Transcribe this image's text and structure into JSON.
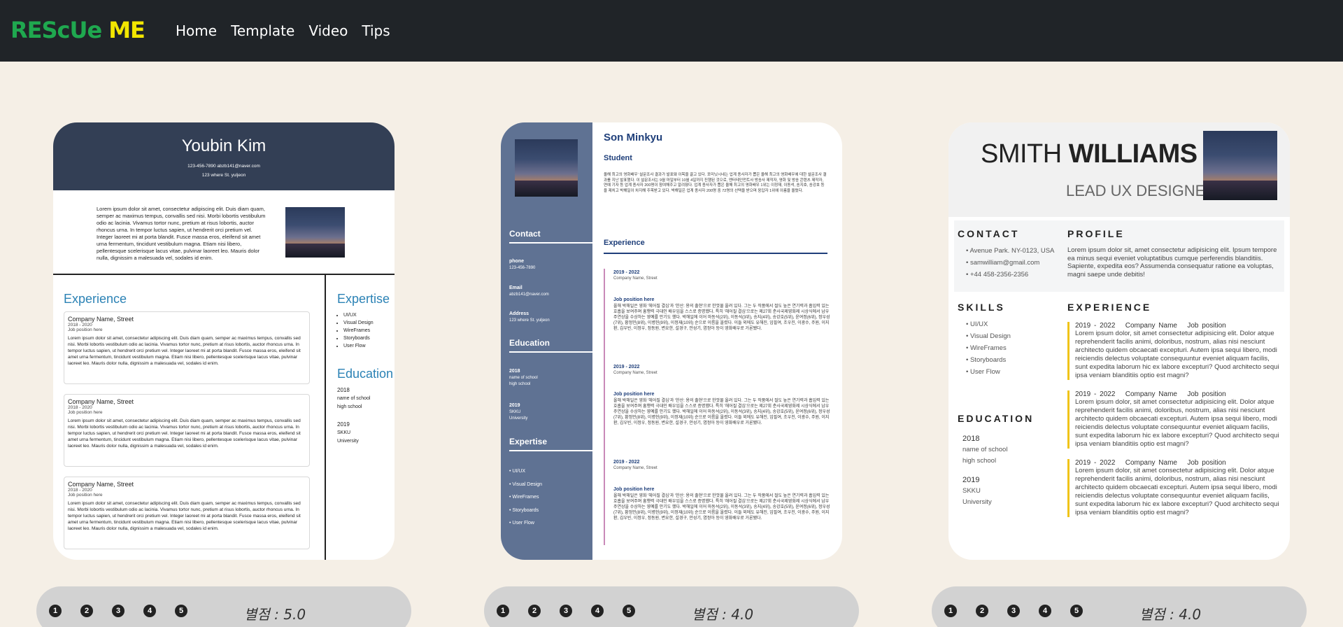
{
  "header": {
    "logo_part1": "REScUe",
    "logo_part2": "ME",
    "nav": [
      "Home",
      "Template",
      "Video",
      "Tips"
    ]
  },
  "card1": {
    "name": "Youbin Kim",
    "contact_line": "123-456-7890     abzb141@naver.com",
    "address": "123 where St. yuljeon",
    "intro": "Lorem ipsum dolor sit amet, consectetur adipiscing elit. Duis diam quam, semper ac maximus tempus, convallis sed nisi. Morbi lobortis vestibulum odio ac lacinia. Vivamus tortor nunc, pretium at risus lobortis, auctor rhoncus urna. In tempor luctus sapien, ut hendrerit orci pretium vel. Integer laoreet mi at porta blandit. Fusce massa eros, eleifend sit amet urna fermentum, tincidunt vestibulum magna. Etiam nisi libero, pellentesque scelerisque lacus vitae, pulvinar laoreet leo. Mauris dolor nulla, dignissim a malesuada vel, sodales id enim.",
    "experience_title": "Experience",
    "jobs": [
      {
        "company": "Company Name, Street",
        "dates": "2018 - 2020",
        "position": "Job position here",
        "body": "Lorem ipsum dolor sit amet, consectetur adipiscing elit. Duis diam quam, semper ac maximus tempus, convallis sed nisi. Morbi lobortis vestibulum odio ac lacinia. Vivamus tortor nunc, pretium at risus lobortis, auctor rhoncus urna. In tempor luctus sapien, ut hendrerit orci pretium vel. Integer laoreet mi at porta blandit. Fusce massa eros, eleifend sit amet urna fermentum, tincidunt vestibulum magna. Etiam nisi libero, pellentesque scelerisque lacus vitae, pulvinar laoreet leo. Mauris dolor nulla, dignissim a malesuada vel, sodales id enim."
      },
      {
        "company": "Company Name, Street",
        "dates": "2018 - 2020",
        "position": "Job position here",
        "body": "Lorem ipsum dolor sit amet, consectetur adipiscing elit. Duis diam quam, semper ac maximus tempus, convallis sed nisi. Morbi lobortis vestibulum odio ac lacinia. Vivamus tortor nunc, pretium at risus lobortis, auctor rhoncus urna. In tempor luctus sapien, ut hendrerit orci pretium vel. Integer laoreet mi at porta blandit. Fusce massa eros, eleifend sit amet urna fermentum, tincidunt vestibulum magna. Etiam nisi libero, pellentesque scelerisque lacus vitae, pulvinar laoreet leo. Mauris dolor nulla, dignissim a malesuada vel, sodales id enim."
      },
      {
        "company": "Company Name, Street",
        "dates": "2018 - 2020",
        "position": "Job position here",
        "body": "Lorem ipsum dolor sit amet, consectetur adipiscing elit. Duis diam quam, semper ac maximus tempus, convallis sed nisi. Morbi lobortis vestibulum odio ac lacinia. Vivamus tortor nunc, pretium at risus lobortis, auctor rhoncus urna. In tempor luctus sapien, ut hendrerit orci pretium vel. Integer laoreet mi at porta blandit. Fusce massa eros, eleifend sit amet urna fermentum, tincidunt vestibulum magna. Etiam nisi libero, pellentesque scelerisque lacus vitae, pulvinar laoreet leo. Mauris dolor nulla, dignissim a malesuada vel, sodales id enim."
      }
    ],
    "expertise_title": "Expertise",
    "expertise": [
      "UI/UX",
      "Visual Design",
      "WireFrames",
      "Storyboards",
      "User Flow"
    ],
    "education_title": "Education",
    "education": [
      {
        "year": "2018",
        "line1": "name of school",
        "line2": "high school"
      },
      {
        "year": "2019",
        "line1": "SKKU",
        "line2": "University"
      }
    ]
  },
  "card2": {
    "name": "Son Minkyu",
    "role": "Student",
    "intro": "올해 최고의 영화배우' 설문조사 결과가 발표돼 이목을 끌고 있다. 포미닛시네는 업계 종사자가 뽑은 올해 최고의 영화배우에 대한 설문조사 결과를 지난 발표했다. 이 설문조사는 9월 마일부터 10월 4일까지 진행된 것으로, 엔터테인먼트사 방송사 제작자, 영화 및 방송 콘텐츠 제작자, 연예 기자 등 업계 종사자 200명이 참여해주고 알려졌다. 업계 종사자가 뽑은 올해 최고의 영화배우 1위는 이정재, 이동석, 송지호, 송강호 등을 제치고 박해일이 차지해 주목받고 있다. 박해일은 업계 종사자 200명 중 72명의 선택을 받으며 응답자 1위에 이름을 올렸다.",
    "sidebar": {
      "contact_title": "Contact",
      "phone_label": "phone",
      "phone": "123-456-7890",
      "email_label": "Email",
      "email": "abzb141@naver.com",
      "address_label": "Address",
      "address": "123 where St. yuljeon",
      "education_title": "Education",
      "edu": [
        {
          "year": "2018",
          "line1": "name of school",
          "line2": "high school"
        },
        {
          "year": "2019",
          "line1": "SKKU",
          "line2": "University"
        }
      ],
      "expertise_title": "Expertise",
      "expertise": [
        "UI/UX",
        "Visual Design",
        "WireFrames",
        "Storyboards",
        "User Flow"
      ]
    },
    "experience_title": "Experience",
    "entries": [
      {
        "years": "2019 - 2022",
        "company": "Company Name, Street",
        "position": "Job position here",
        "body": "올해 박해일은 영화 '헤어질 결심'과 '한산: 용의 출현'으로 한껏물 올려 있다. 그는 두 작품에서 절도 높은 연기력과 흡입력 있는 호흡을 보여주며 흥행력 극대인 배우임을 스스로 증명했다. 특히 '헤어질 결심'으로는 제27회 춘사국제영화제 시상식에서 남우주연상을 수상하는 영예를 안기도 했다. 박해일에 이어 마동석(2위), 이동석(3위), 송지(4위), 송강호(5위), 윤여정(6위), 정우성(7위), 황정민(8위), 이병헌(9위), 이정재(10위) 순으로 이름을 올렸다. 이들 외에도 유해진, 임필여, 조우진, 이광수, 주원, 이지환, 김우빈, 이정우, 정동원, 변요한, 설경구, 안성기, 염정아 등이 영화배우로 거론됐다."
      },
      {
        "years": "2019 - 2022",
        "company": "Company Name, Street",
        "position": "Job position here",
        "body": "올해 박해일은 영화 '헤어질 결심'과 '한산: 용의 출현'으로 한껏물 올려 있다. 그는 두 작품에서 절도 높은 연기력과 흡입력 있는 호흡을 보여주며 흥행력 극대인 배우임을 스스로 증명했다. 특히 '헤어질 결심'으로는 제27회 춘사국제영화제 시상식에서 남우주연상을 수상하는 영예를 안기도 했다. 박해일에 이어 마동석(2위), 이동석(3위), 송지(4위), 송강호(5위), 윤여정(6위), 정우성(7위), 황정민(8위), 이병헌(9위), 이정재(10위) 순으로 이름을 올렸다. 이들 외에도 유해진, 임필여, 조우진, 이광수, 주원, 이지환, 김우빈, 이정우, 정동원, 변요한, 설경구, 안성기, 염정아 등이 영화배우로 거론됐다."
      },
      {
        "years": "2019 - 2022",
        "company": "Company Name, Street",
        "position": "Job position here",
        "body": "올해 박해일은 영화 '헤어질 결심'과 '한산: 용의 출현'으로 한껏물 올려 있다. 그는 두 작품에서 절도 높은 연기력과 흡입력 있는 호흡을 보여주며 흥행력 극대인 배우임을 스스로 증명했다. 특히 '헤어질 결심'으로는 제27회 춘사국제영화제 시상식에서 남우주연상을 수상하는 영예를 안기도 했다. 박해일에 이어 마동석(2위), 이동석(3위), 송지(4위), 송강호(5위), 윤여정(6위), 정우성(7위), 황정민(8위), 이병헌(9위), 이정재(10위) 순으로 이름을 올렸다. 이들 외에도 유해진, 임필여, 조우진, 이광수, 주원, 이지환, 김우빈, 이정우, 정동원, 변요한, 설경구, 안성기, 염정아 등이 영화배우로 거론됐다."
      }
    ]
  },
  "card3": {
    "first_name": "SMITH",
    "last_name": "WILLIAMS",
    "role": "LEAD UX DESIGNER",
    "contact_title": "CONTACT",
    "contact": [
      "Avenue Park. NY-0123, USA",
      "samwilliam@gmail.com",
      "+44 458-2356-2356"
    ],
    "profile_title": "PROFILE",
    "profile": "Lorem ipsum dolor sit, amet consectetur adipisicing elit. Ipsum tempore ea minus sequi eveniet voluptatibus cumque perferendis blanditiis. Sapiente, expedita eos? Assumenda consequatur ratione ea voluptas, magni saepe unde debitis!",
    "skills_title": "SKILLS",
    "skills": [
      "UI/UX",
      "Visual Design",
      "WireFrames",
      "Storyboards",
      "User Flow"
    ],
    "education_title": "EDUCATION",
    "education": [
      {
        "year": "2018",
        "line1": "name of school",
        "line2": "high school"
      },
      {
        "year": "2019",
        "line1": "SKKU",
        "line2": "University"
      }
    ],
    "experience_title": "EXPERIENCE",
    "experience": [
      {
        "years": "2019 - 2022",
        "company": "Company Name",
        "position": "Job position",
        "body": "Lorem ipsum dolor, sit amet consectetur adipisicing elit. Dolor atque reprehenderit facilis animi, doloribus, nostrum, alias nisi nesciunt architecto quidem obcaecati excepturi. Autem ipsa sequi libero, modi reiciendis delectus voluptate consequuntur eveniet aliquam facilis, sunt expedita laborum hic ex labore excepturi? Quod architecto sequi ipsa veniam blanditiis optio est magni?"
      },
      {
        "years": "2019 - 2022",
        "company": "Company Name",
        "position": "Job position",
        "body": "Lorem ipsum dolor, sit amet consectetur adipisicing elit. Dolor atque reprehenderit facilis animi, doloribus, nostrum, alias nisi nesciunt architecto quidem obcaecati excepturi. Autem ipsa sequi libero, modi reiciendis delectus voluptate consequuntur eveniet aliquam facilis, sunt expedita laborum hic ex labore excepturi? Quod architecto sequi ipsa veniam blanditiis optio est magni?"
      },
      {
        "years": "2019 - 2022",
        "company": "Company Name",
        "position": "Job position",
        "body": "Lorem ipsum dolor, sit amet consectetur adipisicing elit. Dolor atque reprehenderit facilis animi, doloribus, nostrum, alias nisi nesciunt architecto quidem obcaecati excepturi. Autem ipsa sequi libero, modi reiciendis delectus voluptate consequuntur eveniet aliquam facilis, sunt expedita laborum hic ex labore excepturi? Quod architecto sequi ipsa veniam blanditiis optio est magni?"
      }
    ]
  },
  "ratings": [
    {
      "buttons": [
        "1",
        "2",
        "3",
        "4",
        "5"
      ],
      "score": "별점 : 5.0"
    },
    {
      "buttons": [
        "1",
        "2",
        "3",
        "4",
        "5"
      ],
      "score": "별점 : 4.0"
    },
    {
      "buttons": [
        "1",
        "2",
        "3",
        "4",
        "5"
      ],
      "score": "별점 : 4.0"
    }
  ]
}
